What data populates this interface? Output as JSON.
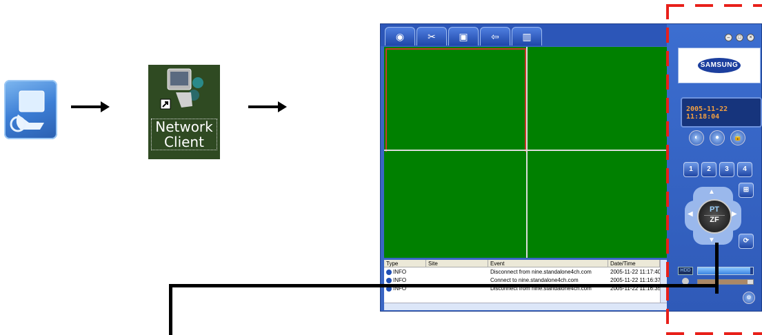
{
  "desktop_icon": {
    "icon": "camera-monitor-icon"
  },
  "shortcut": {
    "label": "Network Client",
    "icon": "computer-shortcut-icon"
  },
  "toolbar": {
    "tabs": [
      {
        "icon": "live-view-icon"
      },
      {
        "icon": "settings-tools-icon"
      },
      {
        "icon": "search-playback-icon"
      },
      {
        "icon": "exit-icon"
      },
      {
        "icon": "split-screen-icon"
      }
    ]
  },
  "log": {
    "headers": [
      "Type",
      "Site",
      "Event",
      "Date/Time"
    ],
    "rows": [
      {
        "type": "INFO",
        "site": "",
        "event": "Disconnect from nine.standalone4ch.com",
        "datetime": "2005-11-22 11:17:40"
      },
      {
        "type": "INFO",
        "site": "",
        "event": "Connect to nine.standalone4ch.com",
        "datetime": "2005-11-22 11:16:37"
      },
      {
        "type": "INFO",
        "site": "",
        "event": "Disconnect from nine.standalone4ch.com",
        "datetime": "2005-11-22 11:16:35"
      }
    ]
  },
  "panel": {
    "brand": "SAMSUNG",
    "clock": "2005-11-22 11:18:04",
    "channels": [
      "1",
      "2",
      "3",
      "4"
    ],
    "ptz_top": "PT",
    "ptz_bottom": "ZF",
    "hdd_label": "HDD",
    "hdd_usage": 0.95,
    "volume_level": 0.9
  },
  "colors": {
    "video_bg": "#008000",
    "selected_cell": "#c83a2a",
    "annotation": "#e8201a"
  }
}
